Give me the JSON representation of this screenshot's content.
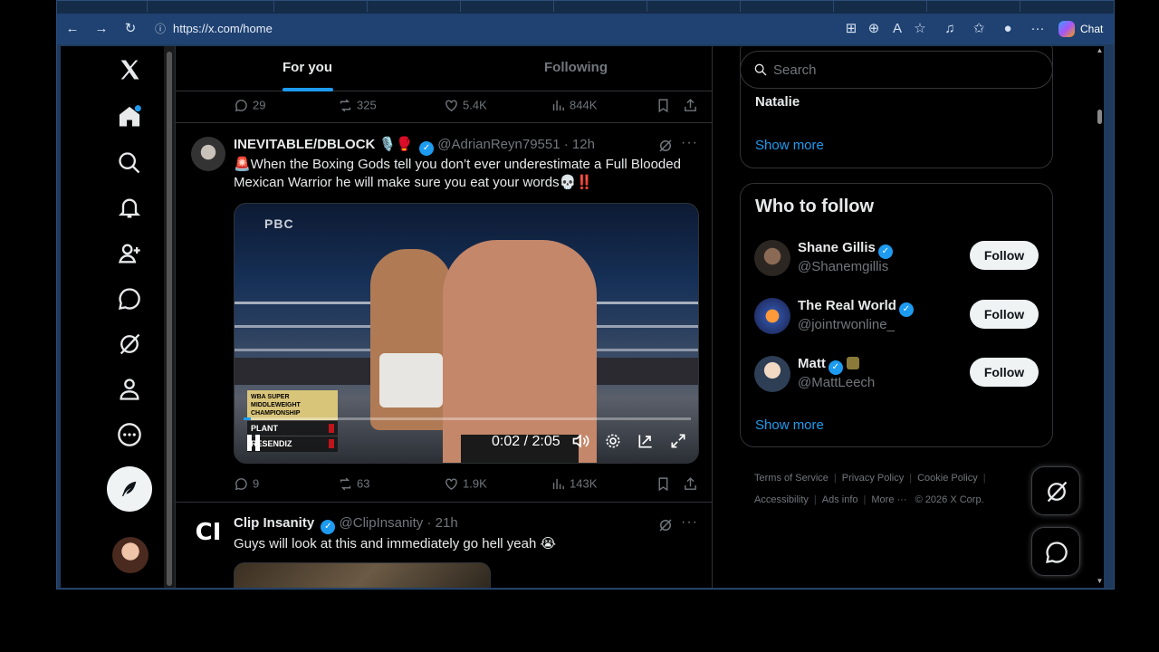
{
  "browser": {
    "url": "https://x.com/home",
    "chat_label": "Chat"
  },
  "tabs": {
    "for_you": "For you",
    "following": "Following"
  },
  "prev_tweet_actions": {
    "replies": "29",
    "reposts": "325",
    "likes": "5.4K",
    "views": "844K"
  },
  "tweet1": {
    "name": "INEVITABLE/DBLOCK",
    "name_emojis": "🎙️🥊",
    "handle": "@AdrianReyn79551",
    "time": "· 12h",
    "text": "🚨When the Boxing Gods tell you don’t ever underestimate a Full Blooded Mexican Warrior he will make sure you eat your words💀‼️",
    "video": {
      "overlay_logo": "PBC",
      "scorebug_title": "WBA SUPER MIDDLEWEIGHT CHAMPIONSHIP",
      "fighter_a": "PLANT",
      "fighter_b": "RESENDIZ",
      "time": "0:02 / 2:05",
      "progress_fraction": 0.016
    },
    "actions": {
      "replies": "9",
      "reposts": "63",
      "likes": "1.9K",
      "views": "143K"
    }
  },
  "tweet2": {
    "avatar_text": "CI",
    "name": "Clip Insanity",
    "handle": "@ClipInsanity",
    "time": "· 21h",
    "text": "Guys will look at this and immediately go hell yeah 😭"
  },
  "sidebar": {
    "search_placeholder": "Search",
    "trend_item": "Natalie",
    "show_more": "Show more",
    "who_to_follow_title": "Who to follow",
    "follow_label": "Follow",
    "suggestions": [
      {
        "name": "Shane Gillis",
        "handle": "@Shanemgillis"
      },
      {
        "name": "The Real World",
        "handle": "@jointrwonline_"
      },
      {
        "name": "Matt",
        "handle": "@MattLeech"
      }
    ],
    "footer": {
      "terms": "Terms of Service",
      "privacy": "Privacy Policy",
      "cookie": "Cookie Policy",
      "accessibility": "Accessibility",
      "ads": "Ads info",
      "more": "More ···",
      "copyright": "© 2026 X Corp."
    }
  },
  "colors": {
    "accent": "#1d9bf0",
    "background": "#000000",
    "text_primary": "#e7e9ea",
    "text_secondary": "#71767b",
    "border": "#2f3336",
    "browser_toolbar": "#1f4272"
  },
  "icons": {
    "nav": [
      "x-logo-icon",
      "home-icon",
      "search-icon",
      "bell-icon",
      "add-person-icon",
      "messages-icon",
      "grok-icon",
      "profile-icon",
      "more-icon",
      "post-feather-icon"
    ]
  }
}
